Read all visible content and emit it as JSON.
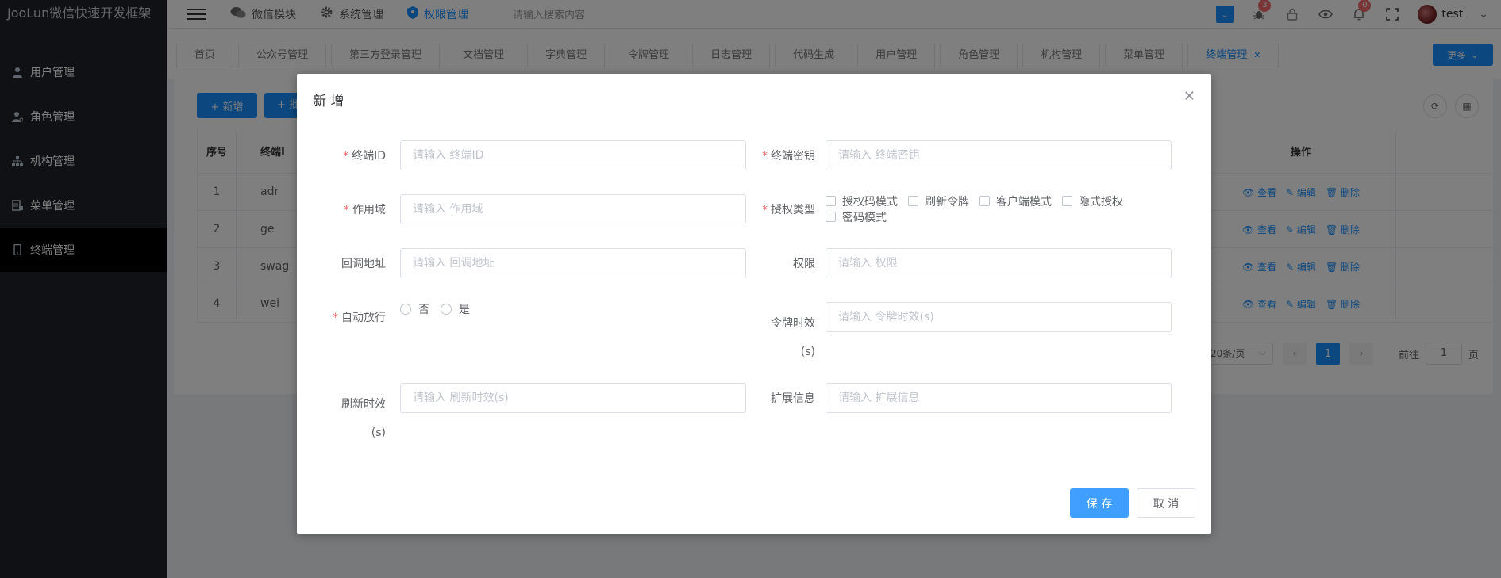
{
  "app": {
    "brand": "JooLun微信快速开发框架"
  },
  "sidebar": {
    "items": [
      {
        "label": "用户管理",
        "icon": "user-icon"
      },
      {
        "label": "角色管理",
        "icon": "user-role-icon"
      },
      {
        "label": "机构管理",
        "icon": "org-tree-icon"
      },
      {
        "label": "菜单管理",
        "icon": "menu-list-icon"
      },
      {
        "label": "终端管理",
        "icon": "mobile-icon",
        "active": true
      }
    ]
  },
  "header": {
    "nav": [
      {
        "label": "微信模块",
        "icon": "wechat-icon"
      },
      {
        "label": "系统管理",
        "icon": "gear-icon"
      },
      {
        "label": "权限管理",
        "icon": "shield-icon",
        "active": true
      }
    ],
    "search_placeholder": "请输入搜索内容",
    "bug_badge": "3",
    "bell_badge": "0",
    "username": "test"
  },
  "tags": {
    "items": [
      "首页",
      "公众号管理",
      "第三方登录管理",
      "文档管理",
      "字典管理",
      "令牌管理",
      "日志管理",
      "代码生成",
      "用户管理",
      "角色管理",
      "机构管理",
      "菜单管理",
      "终端管理"
    ],
    "active": "终端管理",
    "more_label": "更多"
  },
  "toolbar": {
    "add_label": "+ 新增",
    "add2_label": "+ 批"
  },
  "table": {
    "headers": {
      "index": "序号",
      "client_id": "终端I",
      "ops": "操作"
    },
    "rows": [
      {
        "index": "1",
        "client_id": "adr"
      },
      {
        "index": "2",
        "client_id": "ge"
      },
      {
        "index": "3",
        "client_id": "swag"
      },
      {
        "index": "4",
        "client_id": "wei"
      }
    ],
    "actions": {
      "view": "查看",
      "edit": "编辑",
      "delete": "删除"
    }
  },
  "pager": {
    "page_size": "20条/页",
    "current": "1",
    "goto_label": "前往",
    "goto_value": "1",
    "page_unit": "页"
  },
  "dialog": {
    "title": "新 增",
    "fields": {
      "client_id": {
        "label": "终端ID",
        "placeholder": "请输入 终端ID"
      },
      "client_secret": {
        "label": "终端密钥",
        "placeholder": "请输入 终端密钥"
      },
      "scope": {
        "label": "作用域",
        "placeholder": "请输入 作用域"
      },
      "grant_type": {
        "label": "授权类型",
        "options": [
          "授权码模式",
          "刷新令牌",
          "客户端模式",
          "隐式授权",
          "密码模式"
        ]
      },
      "redirect_uri": {
        "label": "回调地址",
        "placeholder": "请输入 回调地址"
      },
      "authorities": {
        "label": "权限",
        "placeholder": "请输入 权限"
      },
      "auto_approve": {
        "label": "自动放行",
        "options": [
          "否",
          "是"
        ]
      },
      "token_validity": {
        "label_line1": "令牌时效",
        "label_line2": "(s)",
        "placeholder": "请输入 令牌时效(s)"
      },
      "refresh_validity": {
        "label_line1": "刷新时效",
        "label_line2": "(s)",
        "placeholder": "请输入 刷新时效(s)"
      },
      "additional_info": {
        "label": "扩展信息",
        "placeholder": "请输入 扩展信息"
      }
    },
    "save_label": "保 存",
    "cancel_label": "取 消"
  }
}
